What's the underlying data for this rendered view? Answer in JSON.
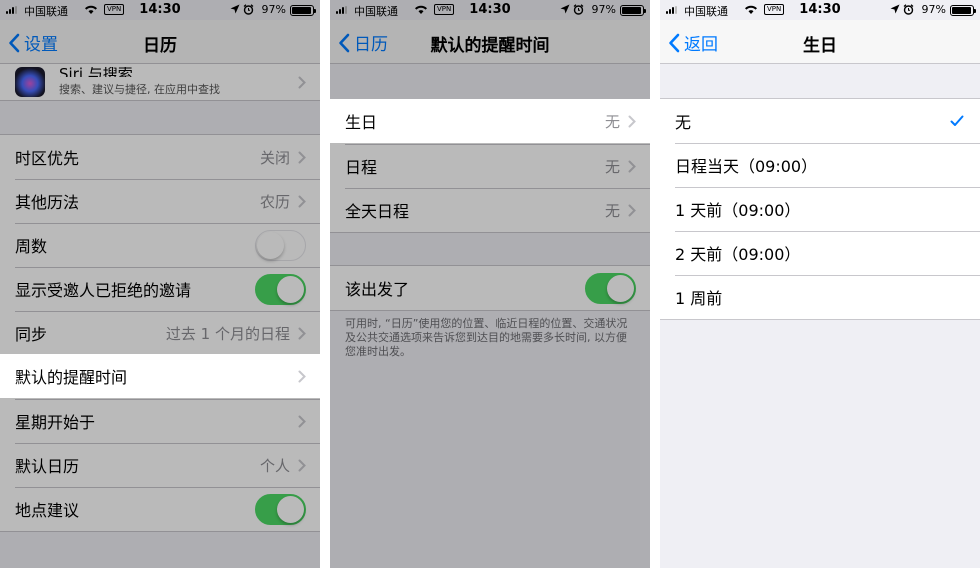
{
  "status_bar": {
    "carrier": "中国联通",
    "vpn": "VPN",
    "time": "14:30",
    "battery": "97%"
  },
  "screen1": {
    "nav": {
      "back": "设置",
      "title": "日历"
    },
    "siri": {
      "title": "Siri 与搜索",
      "subtitle": "搜索、建议与捷径, 在应用中查找"
    },
    "rows": [
      {
        "label": "时区优先",
        "value": "关闭"
      },
      {
        "label": "其他历法",
        "value": "农历"
      },
      {
        "label": "周数",
        "toggle": "off"
      },
      {
        "label": "显示受邀人已拒绝的邀请",
        "toggle": "on"
      },
      {
        "label": "同步",
        "value": "过去 1 个月的日程"
      },
      {
        "label": "默认的提醒时间"
      },
      {
        "label": "星期开始于"
      },
      {
        "label": "默认日历",
        "value": "个人"
      },
      {
        "label": "地点建议",
        "toggle": "on"
      }
    ]
  },
  "screen2": {
    "nav": {
      "back": "日历",
      "title": "默认的提醒时间"
    },
    "rows": [
      {
        "label": "生日",
        "value": "无"
      },
      {
        "label": "日程",
        "value": "无"
      },
      {
        "label": "全天日程",
        "value": "无"
      }
    ],
    "leave": {
      "label": "该出发了",
      "toggle": "on"
    },
    "footer": "可用时, “日历”使用您的位置、临近日程的位置、交通状况及公共交通选项来告诉您到达目的地需要多长时间, 以方便您准时出发。"
  },
  "screen3": {
    "nav": {
      "back": "返回",
      "title": "生日"
    },
    "options": [
      {
        "label": "无",
        "selected": true
      },
      {
        "label": "日程当天（09:00）"
      },
      {
        "label": "1 天前（09:00）"
      },
      {
        "label": "2 天前（09:00）"
      },
      {
        "label": "1 周前"
      }
    ]
  },
  "colors": {
    "accent": "#007aff",
    "toggle_on": "#4cd964",
    "background": "#efeff4"
  }
}
